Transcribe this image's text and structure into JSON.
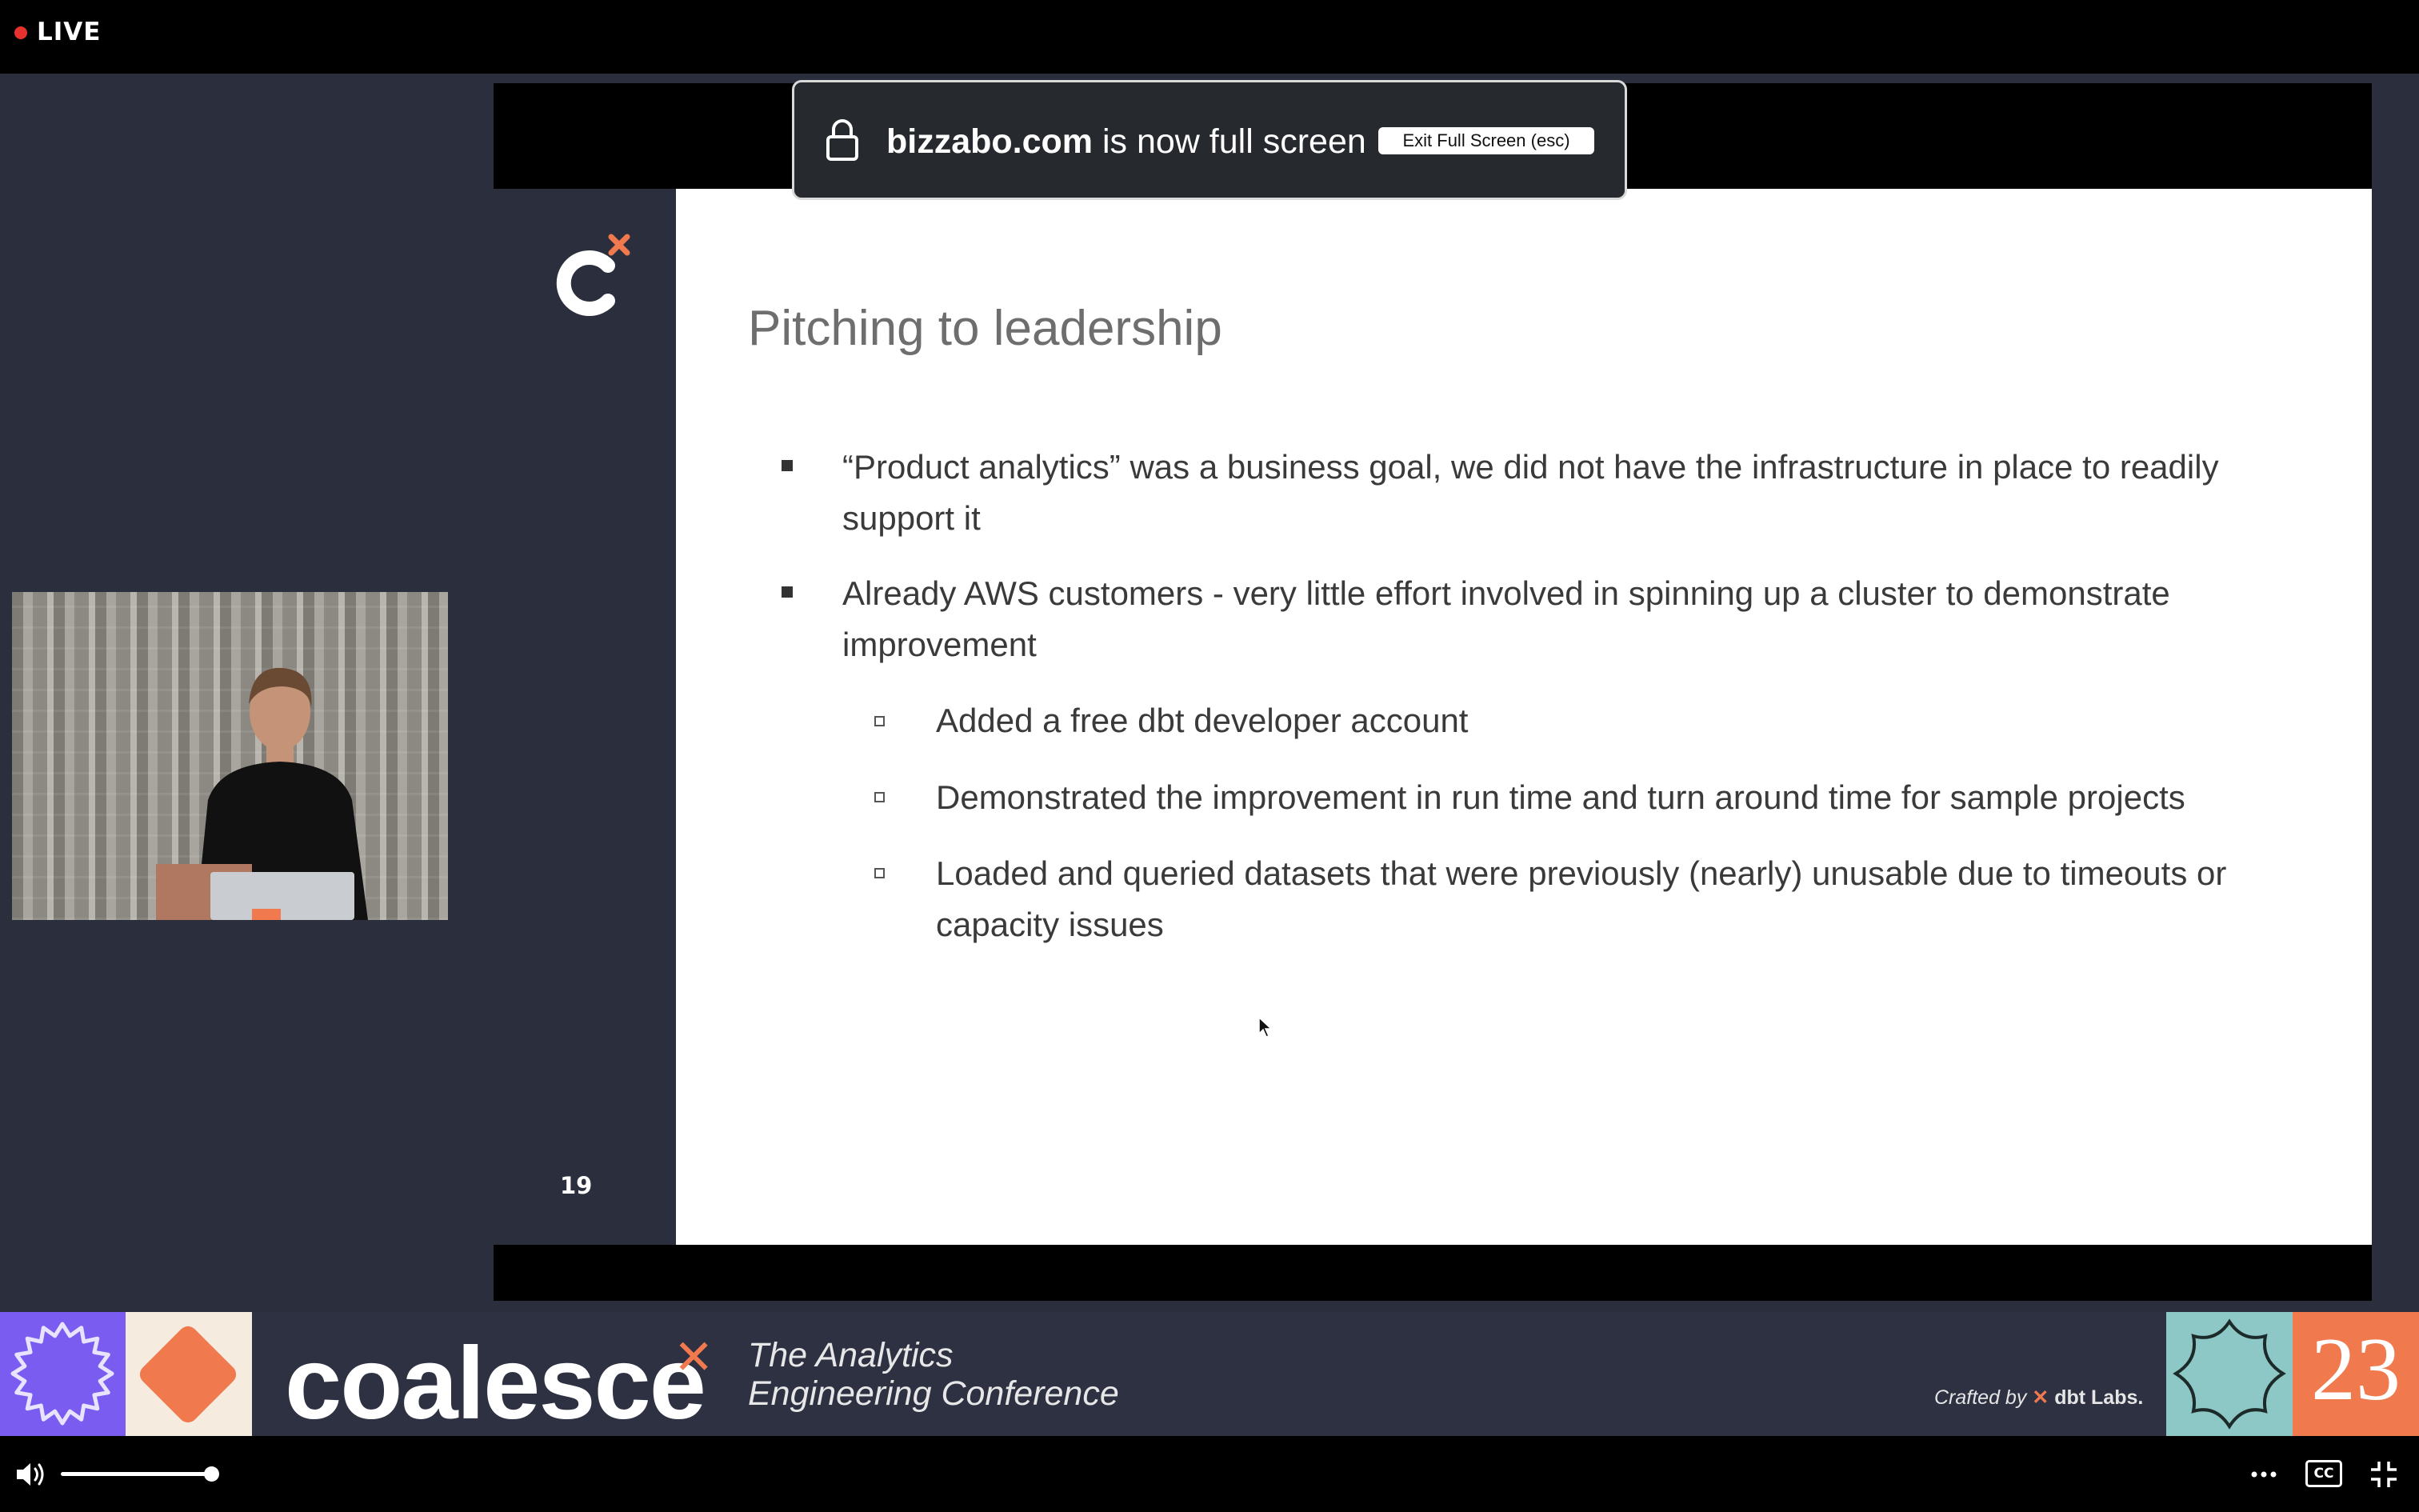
{
  "topbar": {
    "live_label": "LIVE",
    "live_color": "#e5322c"
  },
  "fullscreen_notice": {
    "host": "bizzabo.com",
    "message": " is now full screen",
    "exit_button": "Exit Full Screen (esc)"
  },
  "slide": {
    "number": "19",
    "title": "Pitching to leadership",
    "bullets": [
      {
        "line1": "“Product analytics” was a business goal, we did not have the infrastructure in place to readily",
        "line2": "support it"
      },
      {
        "line1": "Already AWS customers - very little effort involved in spinning up a cluster to demonstrate",
        "line2": "improvement"
      }
    ],
    "sub_bullets": [
      {
        "line1": "Added a free dbt developer account"
      },
      {
        "line1": "Demonstrated the improvement in run time and turn around time for sample projects"
      },
      {
        "line1": "Loaded and queried datasets that were previously (nearly) unusable due to timeouts or",
        "line2": "capacity issues"
      }
    ]
  },
  "banner": {
    "wordmark": "coalesce",
    "tagline_line1": "The Analytics",
    "tagline_line2": "Engineering Conference",
    "crafted_prefix": "Crafted by",
    "crafted_brand": "dbt Labs.",
    "year": "23",
    "accent": "#f07a4e",
    "purple": "#7a5cf0",
    "teal": "#8dc8c6"
  },
  "player": {
    "volume_level": 0.88,
    "cc_label": "CC",
    "icons": [
      "volume-icon",
      "more-options-icon",
      "closed-captions-icon",
      "exit-fullscreen-icon"
    ]
  }
}
